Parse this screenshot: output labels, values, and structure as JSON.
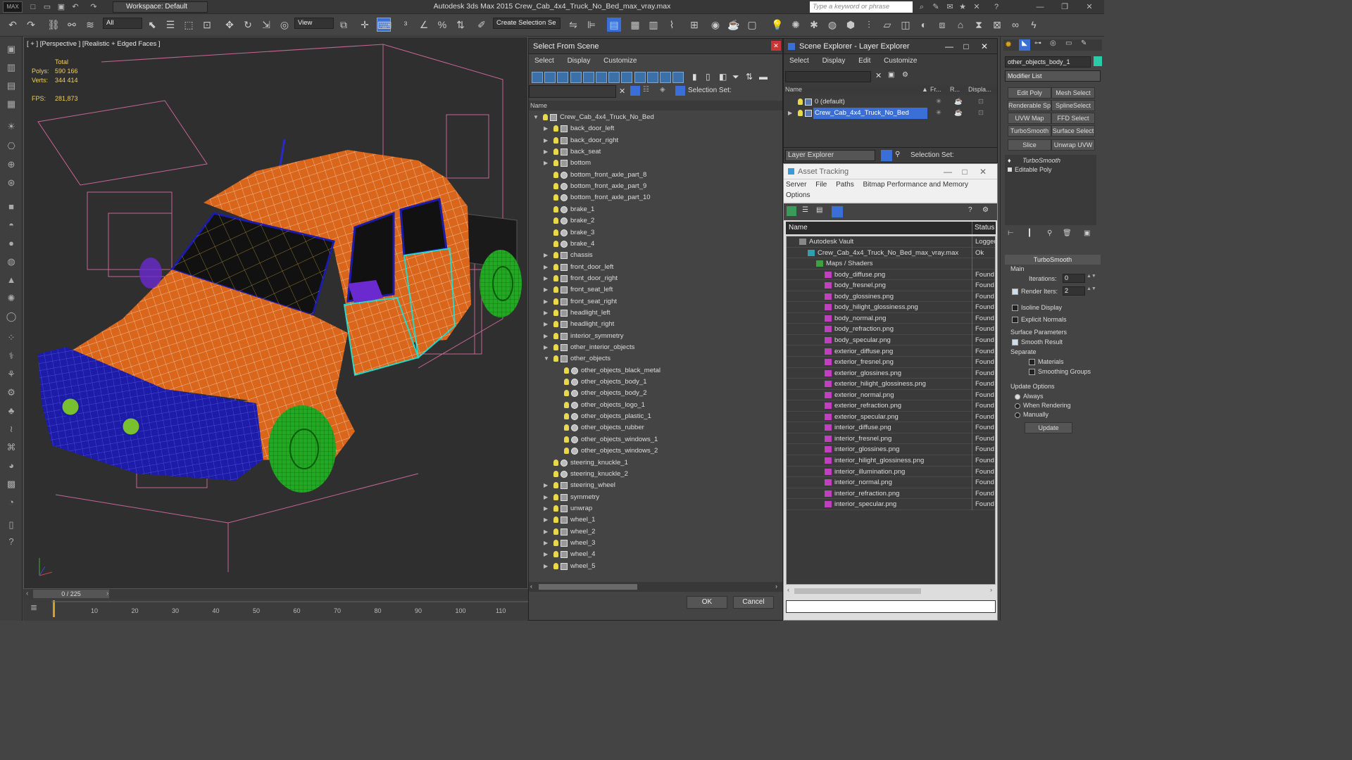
{
  "app": {
    "logo": "MAX",
    "workspace": "Workspace: Default",
    "title": "Autodesk 3ds Max  2015      Crew_Cab_4x4_Truck_No_Bed_max_vray.max",
    "search_placeholder": "Type a keyword or phrase"
  },
  "toolbar": {
    "filter_value": "All",
    "refcoord_value": "View",
    "selection_set_placeholder": "Create Selection Se"
  },
  "viewport": {
    "label": "[ + ] [Perspective ] [Realistic + Edged Faces ]",
    "stats_header": "Total",
    "polys_label": "Polys:",
    "polys_value": "590 166",
    "verts_label": "Verts:",
    "verts_value": "344 414",
    "fps_label": "FPS:",
    "fps_value": "281,873"
  },
  "timeline": {
    "frame": "0 / 225",
    "ticks": [
      "10",
      "20",
      "30",
      "40",
      "50",
      "60",
      "70",
      "80",
      "90",
      "100",
      "110"
    ]
  },
  "select_from_scene": {
    "title": "Select From Scene",
    "menus": [
      "Select",
      "Display",
      "Customize"
    ],
    "selection_set_label": "Selection Set:",
    "column_name": "Name",
    "ok_label": "OK",
    "cancel_label": "Cancel",
    "items": [
      {
        "label": "Crew_Cab_4x4_Truck_No_Bed",
        "level": 0,
        "exp": "open",
        "kind": "grp"
      },
      {
        "label": "back_door_left",
        "level": 1,
        "exp": "closed",
        "kind": "grp"
      },
      {
        "label": "back_door_right",
        "level": 1,
        "exp": "closed",
        "kind": "grp"
      },
      {
        "label": "back_seat",
        "level": 1,
        "exp": "closed",
        "kind": "grp"
      },
      {
        "label": "bottom",
        "level": 1,
        "exp": "closed",
        "kind": "grp"
      },
      {
        "label": "bottom_front_axle_part_8",
        "level": 1,
        "exp": "none",
        "kind": "obj"
      },
      {
        "label": "bottom_front_axle_part_9",
        "level": 1,
        "exp": "none",
        "kind": "obj"
      },
      {
        "label": "bottom_front_axle_part_10",
        "level": 1,
        "exp": "none",
        "kind": "obj"
      },
      {
        "label": "brake_1",
        "level": 1,
        "exp": "none",
        "kind": "obj"
      },
      {
        "label": "brake_2",
        "level": 1,
        "exp": "none",
        "kind": "obj"
      },
      {
        "label": "brake_3",
        "level": 1,
        "exp": "none",
        "kind": "obj"
      },
      {
        "label": "brake_4",
        "level": 1,
        "exp": "none",
        "kind": "obj"
      },
      {
        "label": "chassis",
        "level": 1,
        "exp": "closed",
        "kind": "grp"
      },
      {
        "label": "front_door_left",
        "level": 1,
        "exp": "closed",
        "kind": "grp"
      },
      {
        "label": "front_door_right",
        "level": 1,
        "exp": "closed",
        "kind": "grp"
      },
      {
        "label": "front_seat_left",
        "level": 1,
        "exp": "closed",
        "kind": "grp"
      },
      {
        "label": "front_seat_right",
        "level": 1,
        "exp": "closed",
        "kind": "grp"
      },
      {
        "label": "headlight_left",
        "level": 1,
        "exp": "closed",
        "kind": "grp"
      },
      {
        "label": "headlight_right",
        "level": 1,
        "exp": "closed",
        "kind": "grp"
      },
      {
        "label": "interior_symmetry",
        "level": 1,
        "exp": "closed",
        "kind": "grp"
      },
      {
        "label": "other_interior_objects",
        "level": 1,
        "exp": "closed",
        "kind": "grp"
      },
      {
        "label": "other_objects",
        "level": 1,
        "exp": "open",
        "kind": "grp"
      },
      {
        "label": "other_objects_black_metal",
        "level": 2,
        "exp": "none",
        "kind": "obj"
      },
      {
        "label": "other_objects_body_1",
        "level": 2,
        "exp": "none",
        "kind": "obj"
      },
      {
        "label": "other_objects_body_2",
        "level": 2,
        "exp": "none",
        "kind": "obj"
      },
      {
        "label": "other_objects_logo_1",
        "level": 2,
        "exp": "none",
        "kind": "obj"
      },
      {
        "label": "other_objects_plastic_1",
        "level": 2,
        "exp": "none",
        "kind": "obj"
      },
      {
        "label": "other_objects_rubber",
        "level": 2,
        "exp": "none",
        "kind": "obj"
      },
      {
        "label": "other_objects_windows_1",
        "level": 2,
        "exp": "none",
        "kind": "obj"
      },
      {
        "label": "other_objects_windows_2",
        "level": 2,
        "exp": "none",
        "kind": "obj"
      },
      {
        "label": "steering_knuckle_1",
        "level": 1,
        "exp": "none",
        "kind": "obj"
      },
      {
        "label": "steering_knuckle_2",
        "level": 1,
        "exp": "none",
        "kind": "obj"
      },
      {
        "label": "steering_wheel",
        "level": 1,
        "exp": "closed",
        "kind": "grp"
      },
      {
        "label": "symmetry",
        "level": 1,
        "exp": "closed",
        "kind": "grp"
      },
      {
        "label": "unwrap",
        "level": 1,
        "exp": "closed",
        "kind": "grp"
      },
      {
        "label": "wheel_1",
        "level": 1,
        "exp": "closed",
        "kind": "grp"
      },
      {
        "label": "wheel_2",
        "level": 1,
        "exp": "closed",
        "kind": "grp"
      },
      {
        "label": "wheel_3",
        "level": 1,
        "exp": "closed",
        "kind": "grp"
      },
      {
        "label": "wheel_4",
        "level": 1,
        "exp": "closed",
        "kind": "grp"
      },
      {
        "label": "wheel_5",
        "level": 1,
        "exp": "closed",
        "kind": "grp"
      }
    ]
  },
  "scene_explorer": {
    "title": "Scene Explorer - Layer Explorer",
    "menus": [
      "Select",
      "Display",
      "Edit",
      "Customize"
    ],
    "columns": [
      "Name",
      "Fr...",
      "R...",
      "Displa..."
    ],
    "layers": [
      {
        "label": "0 (default)",
        "selected": false
      },
      {
        "label": "Crew_Cab_4x4_Truck_No_Bed",
        "selected": true
      }
    ],
    "footer_combo": "Layer Explorer",
    "selection_set_label": "Selection Set:"
  },
  "asset_tracking": {
    "title": "Asset Tracking",
    "menus": [
      "Server",
      "File",
      "Paths",
      "Bitmap Performance and Memory"
    ],
    "menu2": "Options",
    "col_name": "Name",
    "col_status": "Status",
    "rows": [
      {
        "name": "Autodesk Vault",
        "status": "Logged",
        "indent": 1,
        "kind": "vault"
      },
      {
        "name": "Crew_Cab_4x4_Truck_No_Bed_max_vray.max",
        "status": "Ok",
        "indent": 2,
        "kind": "max"
      },
      {
        "name": "Maps / Shaders",
        "status": "",
        "indent": 3,
        "kind": "maps"
      },
      {
        "name": "body_diffuse.png",
        "status": "Found",
        "indent": 4,
        "kind": "png"
      },
      {
        "name": "body_fresnel.png",
        "status": "Found",
        "indent": 4,
        "kind": "png"
      },
      {
        "name": "body_glossines.png",
        "status": "Found",
        "indent": 4,
        "kind": "png"
      },
      {
        "name": "body_hilight_glossiness.png",
        "status": "Found",
        "indent": 4,
        "kind": "png"
      },
      {
        "name": "body_normal.png",
        "status": "Found",
        "indent": 4,
        "kind": "png"
      },
      {
        "name": "body_refraction.png",
        "status": "Found",
        "indent": 4,
        "kind": "png"
      },
      {
        "name": "body_specular.png",
        "status": "Found",
        "indent": 4,
        "kind": "png"
      },
      {
        "name": "exterior_diffuse.png",
        "status": "Found",
        "indent": 4,
        "kind": "png"
      },
      {
        "name": "exterior_fresnel.png",
        "status": "Found",
        "indent": 4,
        "kind": "png"
      },
      {
        "name": "exterior_glossines.png",
        "status": "Found",
        "indent": 4,
        "kind": "png"
      },
      {
        "name": "exterior_hilight_glossiness.png",
        "status": "Found",
        "indent": 4,
        "kind": "png"
      },
      {
        "name": "exterior_normal.png",
        "status": "Found",
        "indent": 4,
        "kind": "png"
      },
      {
        "name": "exterior_refraction.png",
        "status": "Found",
        "indent": 4,
        "kind": "png"
      },
      {
        "name": "exterior_specular.png",
        "status": "Found",
        "indent": 4,
        "kind": "png"
      },
      {
        "name": "interior_diffuse.png",
        "status": "Found",
        "indent": 4,
        "kind": "png"
      },
      {
        "name": "interior_fresnel.png",
        "status": "Found",
        "indent": 4,
        "kind": "png"
      },
      {
        "name": "interior_glossines.png",
        "status": "Found",
        "indent": 4,
        "kind": "png"
      },
      {
        "name": "interior_hilight_glossiness.png",
        "status": "Found",
        "indent": 4,
        "kind": "png"
      },
      {
        "name": "interior_illumination.png",
        "status": "Found",
        "indent": 4,
        "kind": "png"
      },
      {
        "name": "interior_normal.png",
        "status": "Found",
        "indent": 4,
        "kind": "png"
      },
      {
        "name": "interior_refraction.png",
        "status": "Found",
        "indent": 4,
        "kind": "png"
      },
      {
        "name": "interior_specular.png",
        "status": "Found",
        "indent": 4,
        "kind": "png"
      }
    ]
  },
  "command_panel": {
    "object_name": "other_objects_body_1",
    "modifier_list": "Modifier List",
    "buttons": [
      "Edit Poly",
      "Mesh Select",
      "Renderable Spline",
      "SplineSelect",
      "UVW Map",
      "FFD Select",
      "TurboSmooth",
      "Surface Select",
      "Slice",
      "Unwrap UVW"
    ],
    "stack": [
      "TurboSmooth",
      "Editable Poly"
    ],
    "rollout_title": "TurboSmooth",
    "main_label": "Main",
    "iterations_label": "Iterations:",
    "iterations_value": "0",
    "render_iters_label": "Render Iters:",
    "render_iters_value": "2",
    "isoline_label": "Isoline Display",
    "explicit_normals_label": "Explicit Normals",
    "surface_params_label": "Surface Parameters",
    "smooth_result_label": "Smooth Result",
    "separate_label": "Separate",
    "materials_label": "Materials",
    "smoothing_groups_label": "Smoothing Groups",
    "update_options_label": "Update Options",
    "always_label": "Always",
    "when_rendering_label": "When Rendering",
    "manually_label": "Manually",
    "update_button": "Update"
  },
  "colors": {
    "body": "#d9661a",
    "wire": "#ffffff",
    "bumper": "#1c1ca8",
    "wheels": "#22a822",
    "bbox": "#e070a8",
    "window_wire": "#e6c040",
    "highlight": "#3a6fd8"
  }
}
